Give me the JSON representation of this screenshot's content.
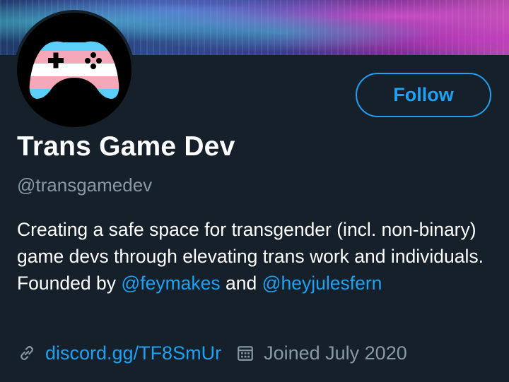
{
  "profile": {
    "name": "Trans Game Dev",
    "handle": "@transgamedev",
    "follow_label": "Follow",
    "bio": {
      "part1": "Creating a safe space for transgender (incl. non-binary) game devs through elevating trans work and individuals. Founded by ",
      "mention1": "@feymakes",
      "part2": " and ",
      "mention2": "@heyjulesfern"
    },
    "website": "discord.gg/TF8SmUr",
    "joined": "Joined July 2020"
  },
  "icons": {
    "link": "link-icon",
    "calendar": "calendar-icon",
    "avatar": "trans-flag-gamepad-logo"
  },
  "colors": {
    "background": "#15202b",
    "accent": "#1da1f2",
    "secondary_text": "#8899a6",
    "flag_blue": "#5bcefa",
    "flag_pink": "#f5a9b8",
    "flag_white": "#ffffff"
  }
}
